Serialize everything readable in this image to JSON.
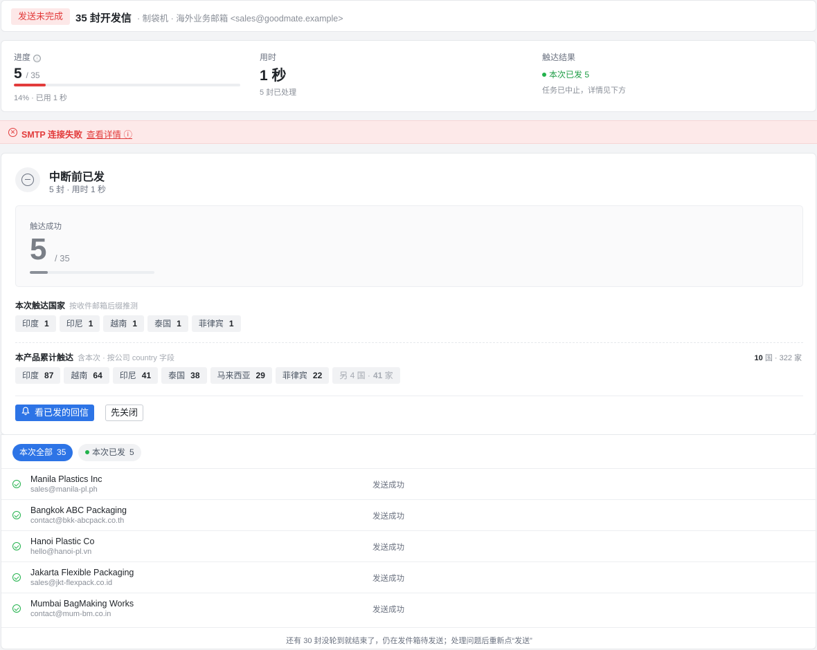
{
  "header": {
    "badge": "发送未完成",
    "title": "35 封开发信",
    "meta": "· 制袋机 · 海外业务邮箱 <sales@goodmate.example>"
  },
  "stats": {
    "progress": {
      "label": "进度",
      "info_icon": "ⓘ",
      "current": "5",
      "total": "/ 35",
      "fraction": 0.14,
      "bar_color": "#e23b3b",
      "sub": "14% · 已用 1 秒"
    },
    "time": {
      "label": "用时",
      "value": "1 秒",
      "sub": "5 封已处理"
    },
    "reach": {
      "label": "触达结果",
      "sent": "本次已发 5",
      "note": "任务已中止，详情见下方"
    }
  },
  "error": {
    "icon": "x-circle-icon",
    "text": "SMTP 连接失败",
    "link": "查看详情",
    "link_icon": "ⓘ"
  },
  "summary": {
    "title": "中断前已发",
    "sub": "5 封 · 用时 1 秒",
    "reached": {
      "label": "触达成功",
      "value": "5",
      "total": "/ 35",
      "fraction": 0.143
    },
    "countries_title": "本次触达国家",
    "countries_hint": "按收件邮箱后缀推测",
    "countries": [
      {
        "name": "印度",
        "count": "1"
      },
      {
        "name": "印尼",
        "count": "1"
      },
      {
        "name": "越南",
        "count": "1"
      },
      {
        "name": "泰国",
        "count": "1"
      },
      {
        "name": "菲律宾",
        "count": "1"
      }
    ],
    "cumulative_title": "本产品累计触达",
    "cumulative_hint": "含本次 · 按公司 country 字段",
    "cumulative_total_num": "10",
    "cumulative_total_rest": "国 · 322 家",
    "cumulative": [
      {
        "name": "印度",
        "count": "87"
      },
      {
        "name": "越南",
        "count": "64"
      },
      {
        "name": "印尼",
        "count": "41"
      },
      {
        "name": "泰国",
        "count": "38"
      },
      {
        "name": "马来西亚",
        "count": "29"
      },
      {
        "name": "菲律宾",
        "count": "22"
      }
    ],
    "cumulative_more": {
      "name": "另 4 国 ·",
      "count": "41",
      "suffix": "家"
    },
    "primary_button": "看已发的回信",
    "secondary_button": "先关闭"
  },
  "list": {
    "tab_all_label": "本次全部",
    "tab_all_count": "35",
    "tab_sent_label": "本次已发",
    "tab_sent_count": "5",
    "rows": [
      {
        "name": "Manila Plastics Inc",
        "email": "sales@manila-pl.ph",
        "status": "发送成功"
      },
      {
        "name": "Bangkok ABC Packaging",
        "email": "contact@bkk-abcpack.co.th",
        "status": "发送成功"
      },
      {
        "name": "Hanoi Plastic Co",
        "email": "hello@hanoi-pl.vn",
        "status": "发送成功"
      },
      {
        "name": "Jakarta Flexible Packaging",
        "email": "sales@jkt-flexpack.co.id",
        "status": "发送成功"
      },
      {
        "name": "Mumbai BagMaking Works",
        "email": "contact@mum-bm.co.in",
        "status": "发送成功"
      }
    ],
    "footer": "还有 30 封没轮到就结束了，仍在发件箱待发送；处理问题后重新点“发送”"
  }
}
